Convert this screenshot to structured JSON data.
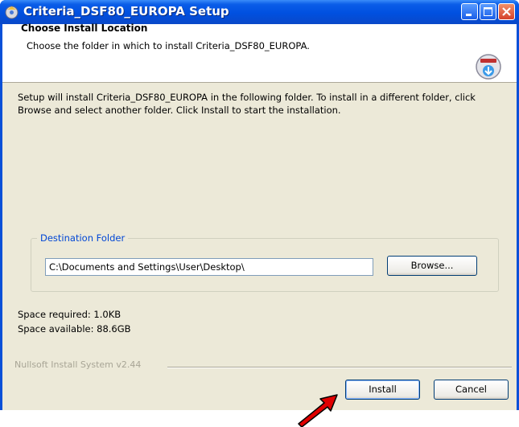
{
  "window": {
    "title": "Criteria_DSF80_EUROPA Setup",
    "title_icon": "setup-disk-icon"
  },
  "header": {
    "title": "Choose Install Location",
    "subtitle": "Choose the folder in which to install Criteria_DSF80_EUROPA.",
    "logo_icon": "installer-disk-icon"
  },
  "body": {
    "description": "Setup will install Criteria_DSF80_EUROPA in the following folder. To install in a different folder, click Browse and select another folder. Click Install to start the installation."
  },
  "destination": {
    "group_label": "Destination Folder",
    "path_value": "C:\\Documents and Settings\\User\\Desktop\\",
    "browse_label": "Browse..."
  },
  "space": {
    "required": "Space required: 1.0KB",
    "available": "Space available: 88.6GB"
  },
  "footer": {
    "brand": "Nullsoft Install System v2.44",
    "install_label": "Install",
    "cancel_label": "Cancel"
  },
  "annotation": {
    "icon": "red-arrow-icon",
    "color": "#e00000"
  },
  "colors": {
    "titlebar": "#0050e0",
    "dialog_bg": "#ece9d8",
    "group_label": "#0046d5"
  }
}
